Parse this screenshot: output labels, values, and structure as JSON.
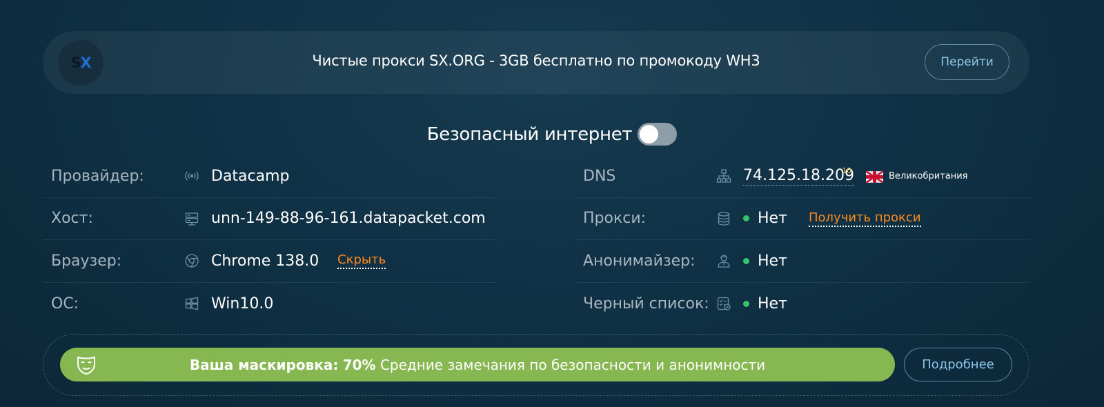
{
  "promo": {
    "logo_s": "S",
    "logo_x": "X",
    "text": "Чистые прокси SX.ORG - 3GB бесплатно по промокоду WH3",
    "button": "Перейти"
  },
  "safe_internet": {
    "label": "Безопасный интернет",
    "enabled": false
  },
  "left": {
    "provider": {
      "label": "Провайдер:",
      "icon": "signal-icon",
      "value": "Datacamp"
    },
    "host": {
      "label": "Хост:",
      "icon": "server-icon",
      "value": "unn-149-88-96-161.datapacket.com"
    },
    "browser": {
      "label": "Браузер:",
      "icon": "chrome-icon",
      "value": "Chrome 138.0",
      "action": "Скрыть"
    },
    "os": {
      "label": "ОС:",
      "icon": "windows-icon",
      "value": "Win10.0"
    }
  },
  "right": {
    "dns": {
      "label": "DNS",
      "icon": "network-icon",
      "value": "74.125.18.209",
      "count": "10",
      "country": "Великобритания",
      "flag": "gb-flag"
    },
    "proxy": {
      "label": "Прокси:",
      "icon": "database-icon",
      "value": "Нет",
      "action": "Получить прокси"
    },
    "anonymizer": {
      "label": "Анонимайзер:",
      "icon": "user-shield-icon",
      "value": "Нет"
    },
    "blacklist": {
      "label": "Черный список:",
      "icon": "checklist-icon",
      "value": "Нет"
    }
  },
  "mask": {
    "label": "Ваша маскировка:",
    "percent": "70%",
    "description": "Средние замечания по безопасности и анонимности",
    "button": "Подробнее"
  },
  "colors": {
    "status_ok": "#36c46a",
    "accent_orange": "#ff8a1e",
    "mask_bar": "#86b751"
  }
}
